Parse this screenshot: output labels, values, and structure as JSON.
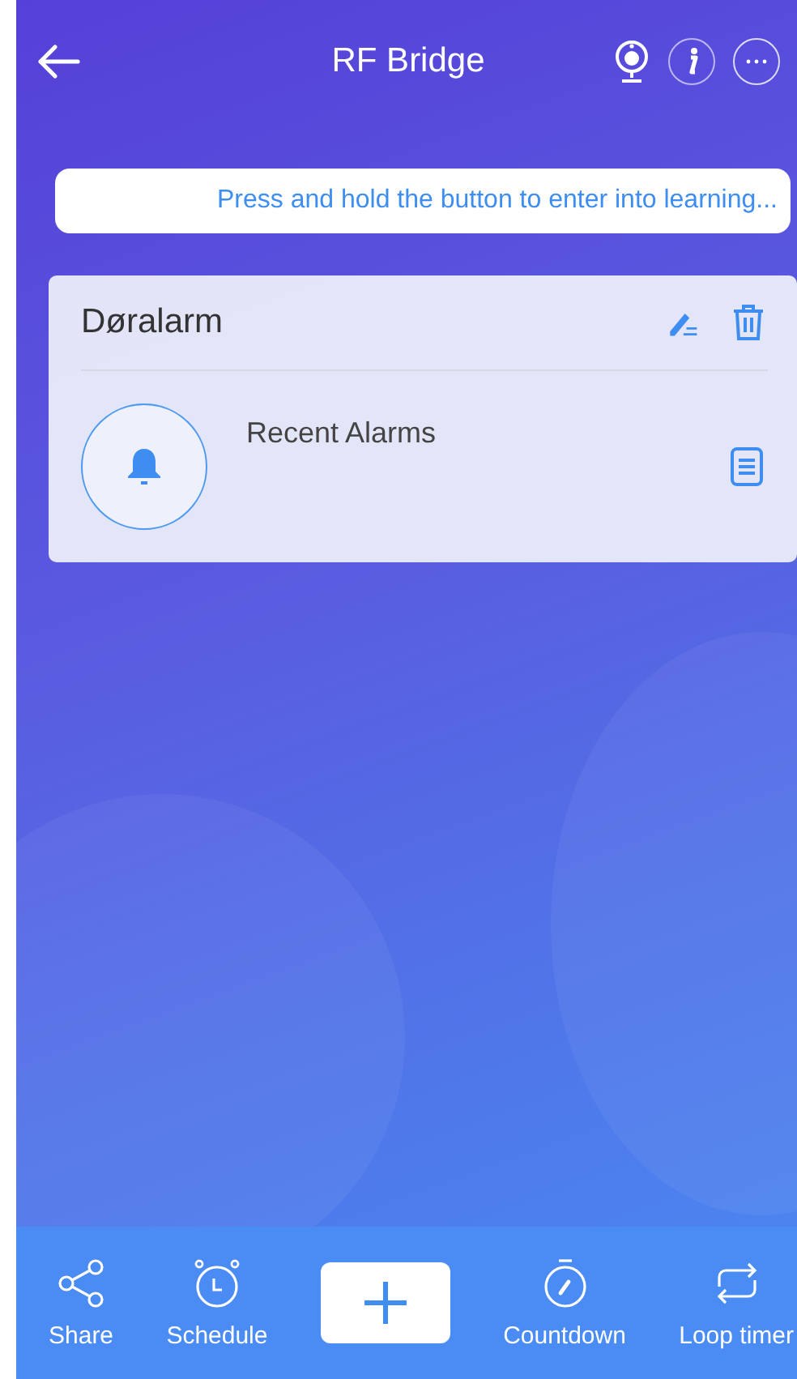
{
  "header": {
    "title": "RF Bridge"
  },
  "hint": {
    "text": "Press and hold the button to enter into learning..."
  },
  "device": {
    "name": "Døralarm",
    "row_label": "Recent Alarms"
  },
  "toolbar": [
    {
      "kind": "share",
      "label": "Share"
    },
    {
      "kind": "schedule",
      "label": "Schedule"
    },
    {
      "kind": "add"
    },
    {
      "kind": "countdown",
      "label": "Countdown"
    },
    {
      "kind": "loop",
      "label": "Loop timer"
    }
  ]
}
